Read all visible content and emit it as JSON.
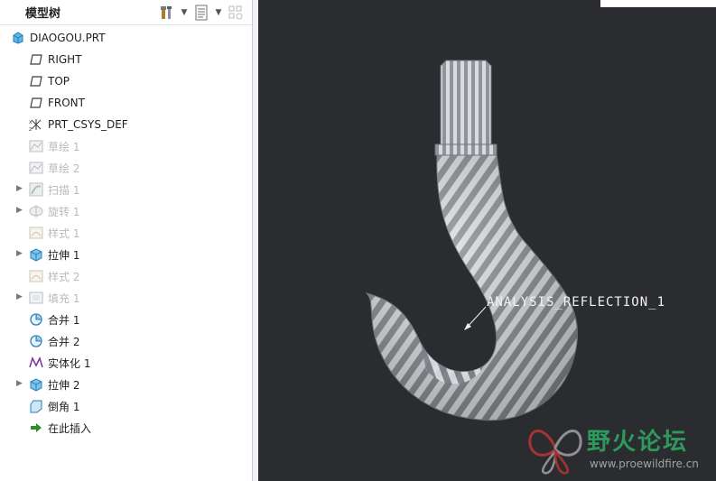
{
  "model_tree": {
    "title": "模型树",
    "root": {
      "label": "DIAOGOU.PRT",
      "icon": "part-icon"
    },
    "items": [
      {
        "label": "RIGHT",
        "icon": "datum-plane-icon",
        "dim": false,
        "expandable": false
      },
      {
        "label": "TOP",
        "icon": "datum-plane-icon",
        "dim": false,
        "expandable": false
      },
      {
        "label": "FRONT",
        "icon": "datum-plane-icon",
        "dim": false,
        "expandable": false
      },
      {
        "label": "PRT_CSYS_DEF",
        "icon": "csys-icon",
        "dim": false,
        "expandable": false
      },
      {
        "label": "草绘 1",
        "icon": "sketch-icon",
        "dim": true,
        "expandable": false
      },
      {
        "label": "草绘 2",
        "icon": "sketch-icon",
        "dim": true,
        "expandable": false
      },
      {
        "label": "扫描 1",
        "icon": "sweep-icon",
        "dim": true,
        "expandable": true
      },
      {
        "label": "旋转 1",
        "icon": "revolve-icon",
        "dim": true,
        "expandable": true
      },
      {
        "label": "样式 1",
        "icon": "style-icon",
        "dim": true,
        "expandable": false
      },
      {
        "label": "拉伸 1",
        "icon": "extrude-icon",
        "dim": false,
        "expandable": true
      },
      {
        "label": "样式 2",
        "icon": "style-icon",
        "dim": true,
        "expandable": false
      },
      {
        "label": "填充 1",
        "icon": "fill-icon",
        "dim": true,
        "expandable": true
      },
      {
        "label": "合并 1",
        "icon": "merge-icon",
        "dim": false,
        "expandable": false
      },
      {
        "label": "合并 2",
        "icon": "merge-icon",
        "dim": false,
        "expandable": false
      },
      {
        "label": "实体化 1",
        "icon": "solidify-icon",
        "dim": false,
        "expandable": false
      },
      {
        "label": "拉伸 2",
        "icon": "extrude-icon",
        "dim": false,
        "expandable": true
      },
      {
        "label": "倒角 1",
        "icon": "chamfer-icon",
        "dim": false,
        "expandable": false
      },
      {
        "label": "在此插入",
        "icon": "insert-here-arrow-icon",
        "dim": false,
        "expandable": false
      }
    ]
  },
  "viewport": {
    "annotation": "ANALYSIS_REFLECTION_1"
  },
  "watermark": {
    "title": "野火论坛",
    "url": "www.proewildfire.cn"
  },
  "colors": {
    "viewport_bg": "#2b2c30",
    "dim_text": "#b7bac0",
    "watermark_green": "#2d9a5c"
  }
}
